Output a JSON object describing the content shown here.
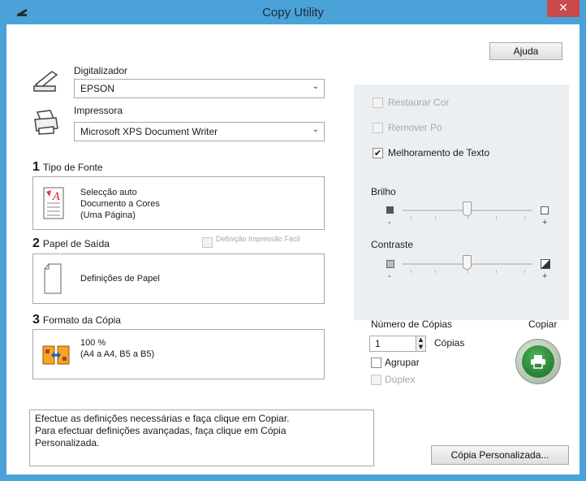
{
  "window": {
    "title": "Copy Utility",
    "close_label": "✕"
  },
  "help_button": "Ajuda",
  "scanner": {
    "label": "Digitalizador",
    "value": "EPSON"
  },
  "printer": {
    "label": "Impressora",
    "value": "Microsoft XPS Document Writer"
  },
  "source": {
    "number": "1",
    "label": "Tipo de Fonte",
    "lines": [
      "Selecção auto",
      "Documento a Cores",
      "(Uma Página)"
    ]
  },
  "output": {
    "number": "2",
    "label": "Papel de Saída",
    "easy_setting": "Definição Impressão Fácil",
    "card_text": "Definições de Papel"
  },
  "format": {
    "number": "3",
    "label": "Formato da Cópia",
    "lines": [
      "100 %",
      "(A4 a A4, B5 a B5)"
    ]
  },
  "options": {
    "restore_color": "Restaurar Cor",
    "remove_dust": "Remover Pó",
    "text_enhance": "Melhoramento de Texto",
    "text_enhance_checked": true
  },
  "brightness": {
    "label": "Brilho",
    "minus": "-",
    "plus": "+",
    "level": 0.5
  },
  "contrast": {
    "label": "Contraste",
    "minus": "-",
    "plus": "+",
    "level": 0.5
  },
  "copies": {
    "label": "Número de Cópias",
    "value": "1",
    "unit": "Cópias",
    "collate": "Agrupar",
    "duplex": "Dúplex"
  },
  "copy_button": {
    "label": "Copiar",
    "color": "#2e8b3a"
  },
  "message": [
    "Efectue as definições necessárias e faça clique em Copiar.",
    "Para efectuar definições avançadas, faça clique em Cópia",
    "Personalizada."
  ],
  "custom_copy_button": "Cópia Personalizada..."
}
